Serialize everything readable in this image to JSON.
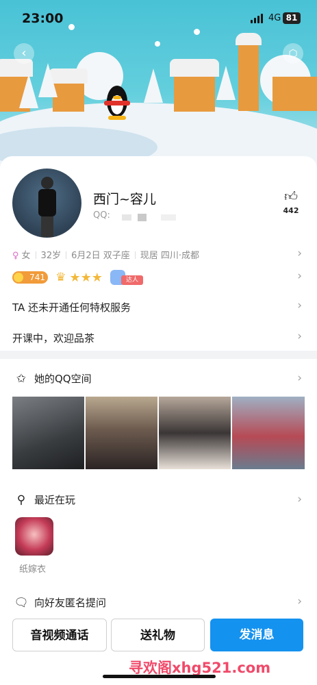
{
  "status": {
    "time": "23:00",
    "network": "4G",
    "battery": "81"
  },
  "profile": {
    "name": "西门~容儿",
    "qq_label": "QQ:",
    "likes": "442"
  },
  "info": {
    "gender": "女",
    "age": "32岁",
    "birthday": "6月2日 双子座",
    "location": "现居 四川·成都"
  },
  "badges": {
    "level": "741",
    "talent_label": "达人"
  },
  "rows": {
    "privilege": "TA 还未开通任何特权服务",
    "signature": "开课中，欢迎品茶"
  },
  "qzone": {
    "title": "她的QQ空间"
  },
  "recent": {
    "title": "最近在玩",
    "game_name": "纸嫁衣"
  },
  "anon": {
    "title": "向好友匿名提问"
  },
  "actions": {
    "call": "音视频通话",
    "gift": "送礼物",
    "message": "发消息"
  },
  "watermark": "寻欢阁xhg521.com",
  "colors": {
    "accent": "#1492f0",
    "sky": "#49c2d6",
    "coin": "#f19b3a",
    "watermark": "#f04a6a"
  },
  "icons": [
    "back-icon",
    "hexagon-menu-icon",
    "thumbs-up-icon",
    "chevron-right-icon",
    "star-outline-icon",
    "location-person-icon",
    "gamepad-icon"
  ]
}
